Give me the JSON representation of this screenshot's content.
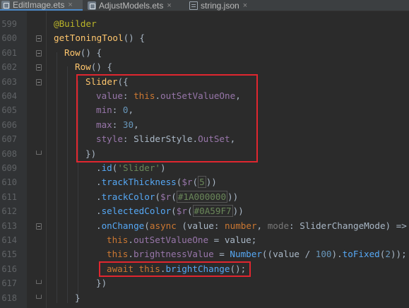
{
  "tabs": [
    {
      "label": "EditImage.ets",
      "icon": "ets-file-icon",
      "active": true
    },
    {
      "label": "AdjustModels.ets",
      "icon": "ets-file-icon",
      "active": false
    },
    {
      "label": "string.json",
      "icon": "json-file-icon",
      "active": false
    }
  ],
  "tab_close_glyph": "×",
  "lines": [
    {
      "num": "599",
      "code": "@Builder"
    },
    {
      "num": "600",
      "code": "getToningTool() {"
    },
    {
      "num": "601",
      "code": "Row() {"
    },
    {
      "num": "602",
      "code": "Row() {"
    },
    {
      "num": "603",
      "code": "Slider({"
    },
    {
      "num": "604",
      "code": "value: this.outSetValueOne,"
    },
    {
      "num": "605",
      "code": "min: 0,"
    },
    {
      "num": "606",
      "code": "max: 30,"
    },
    {
      "num": "607",
      "code": "style: SliderStyle.OutSet,"
    },
    {
      "num": "608",
      "code": "})"
    },
    {
      "num": "609",
      "code": ".id('Slider')"
    },
    {
      "num": "610",
      "code": ".trackThickness($r(5))"
    },
    {
      "num": "611",
      "code": ".trackColor($r(#1A000000))"
    },
    {
      "num": "612",
      "code": ".selectedColor($r(#0A59F7))"
    },
    {
      "num": "613",
      "code": ".onChange(async (value: number, mode: SliderChangeMode) => {"
    },
    {
      "num": "614",
      "code": "this.outSetValueOne = value;"
    },
    {
      "num": "615",
      "code": "this.brightnessValue = Number((value / 100).toFixed(2));"
    },
    {
      "num": "616",
      "code": "await this.brightChange();"
    },
    {
      "num": "617",
      "code": "})"
    },
    {
      "num": "618",
      "code": "}"
    }
  ],
  "colors": {
    "highlight_box": "#e0262f",
    "active_tab_underline": "#4a88c7"
  }
}
